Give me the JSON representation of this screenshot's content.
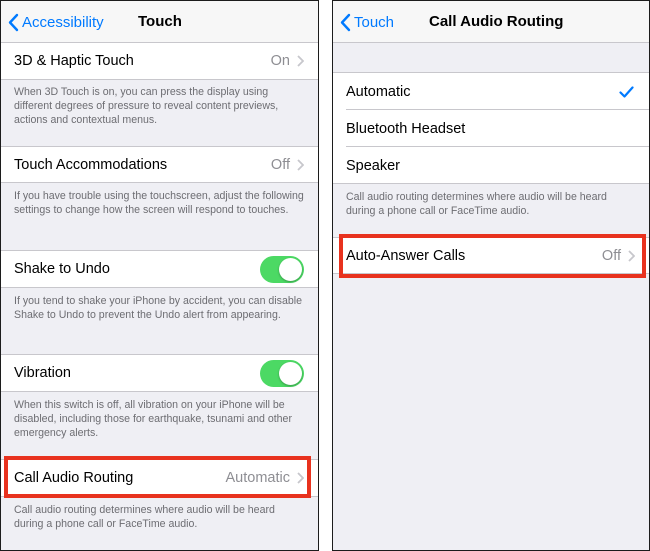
{
  "left": {
    "back_label": "Accessibility",
    "title": "Touch",
    "haptic": {
      "label": "3D & Haptic Touch",
      "value": "On",
      "footer": "When 3D Touch is on, you can press the display using different degrees of pressure to reveal content previews, actions and contextual menus."
    },
    "accommodations": {
      "label": "Touch Accommodations",
      "value": "Off",
      "footer": "If you have trouble using the touchscreen, adjust the following settings to change how the screen will respond to touches."
    },
    "shake": {
      "label": "Shake to Undo",
      "on": true,
      "footer": "If you tend to shake your iPhone by accident, you can disable Shake to Undo to prevent the Undo alert from appearing."
    },
    "vibration": {
      "label": "Vibration",
      "on": true,
      "footer": "When this switch is off, all vibration on your iPhone will be disabled, including those for earthquake, tsunami and other emergency alerts."
    },
    "call_audio": {
      "label": "Call Audio Routing",
      "value": "Automatic",
      "footer": "Call audio routing determines where audio will be heard during a phone call or FaceTime audio."
    }
  },
  "right": {
    "back_label": "Touch",
    "title": "Call Audio Routing",
    "options": [
      {
        "label": "Automatic",
        "selected": true
      },
      {
        "label": "Bluetooth Headset",
        "selected": false
      },
      {
        "label": "Speaker",
        "selected": false
      }
    ],
    "footer": "Call audio routing determines where audio will be heard during a phone call or FaceTime audio.",
    "auto_answer": {
      "label": "Auto-Answer Calls",
      "value": "Off"
    }
  },
  "colors": {
    "accent": "#007aff",
    "toggle_on": "#4cd964",
    "highlight": "#e8321e"
  }
}
